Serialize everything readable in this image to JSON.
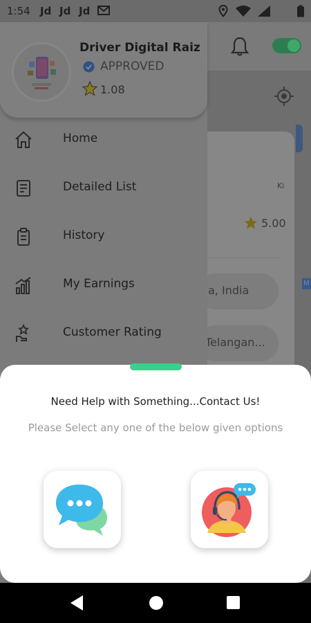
{
  "status_bar": {
    "time": "1:54",
    "notifications": [
      "Jd",
      "Jd",
      "Jd"
    ],
    "icons": [
      "gmail-icon",
      "location-icon",
      "wifi-icon",
      "signal-icon",
      "battery-icon"
    ]
  },
  "background": {
    "card_rating": "5.00",
    "card_address_1": "a, India",
    "card_address_2": "Telangan...",
    "card_tag": "M"
  },
  "drawer": {
    "driver_name": "Driver Digital Raiz",
    "status": "APPROVED",
    "rating": "1.08",
    "menu": [
      {
        "label": "Home",
        "icon": "home-icon"
      },
      {
        "label": "Detailed List",
        "icon": "list-icon"
      },
      {
        "label": "History",
        "icon": "history-icon"
      },
      {
        "label": "My Earnings",
        "icon": "earnings-icon"
      },
      {
        "label": "Customer Rating",
        "icon": "rating-icon"
      }
    ]
  },
  "sheet": {
    "title": "Need Help with Something...Contact Us!",
    "subtitle": "Please Select any one of the below given options",
    "options": [
      {
        "name": "chat",
        "icon": "chat-bubbles-icon"
      },
      {
        "name": "call",
        "icon": "support-agent-icon"
      }
    ]
  },
  "colors": {
    "accent_green": "#3ad08c",
    "verified_blue": "#2f6ed8",
    "star_yellow": "#e6c23a",
    "chat_blue": "#3db9ea",
    "chat_green": "#7fd8a3",
    "agent_red": "#f05d5e"
  }
}
